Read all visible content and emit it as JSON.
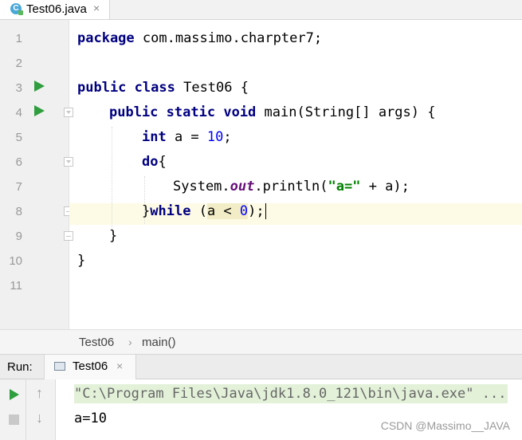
{
  "tab": {
    "file_icon": "java-class-icon",
    "label": "Test06.java",
    "close": "×"
  },
  "gutter": {
    "line_numbers": [
      "1",
      "2",
      "3",
      "4",
      "5",
      "6",
      "7",
      "8",
      "9",
      "10",
      "11"
    ]
  },
  "code": {
    "l1": {
      "kw": "package",
      "rest": " com.massimo.charpter7;"
    },
    "l3": {
      "kw1": "public",
      "kw2": "class",
      "rest": " Test06 {"
    },
    "l4": {
      "kw1": "public",
      "kw2": "static",
      "kw3": "void",
      "rest": " main(String[] args) {"
    },
    "l5": {
      "kw": "int",
      "mid": " a = ",
      "num": "10",
      "end": ";"
    },
    "l6": {
      "kw": "do",
      "end": "{"
    },
    "l7": {
      "a": "System.",
      "fld": "out",
      "b": ".println(",
      "str": "\"a=\"",
      "c": " + a);"
    },
    "l8": {
      "brace": "}",
      "kw": "while",
      "sp": " ",
      "open": "(",
      "a": "a < ",
      "num": "0",
      "close": ")",
      "end": ";"
    },
    "l9": {
      "text": "}"
    },
    "l10": {
      "text": "}"
    }
  },
  "breadcrumb": {
    "items": [
      "Test06",
      "main()"
    ],
    "separator": "›"
  },
  "run": {
    "label": "Run:",
    "tab_label": "Test06",
    "tab_close": "×",
    "output": [
      "\"C:\\Program Files\\Java\\jdk1.8.0_121\\bin\\java.exe\" ...",
      "a=10"
    ],
    "up_arrow": "↑",
    "down_arrow": "↓"
  },
  "watermark": "CSDN @Massimo__JAVA"
}
